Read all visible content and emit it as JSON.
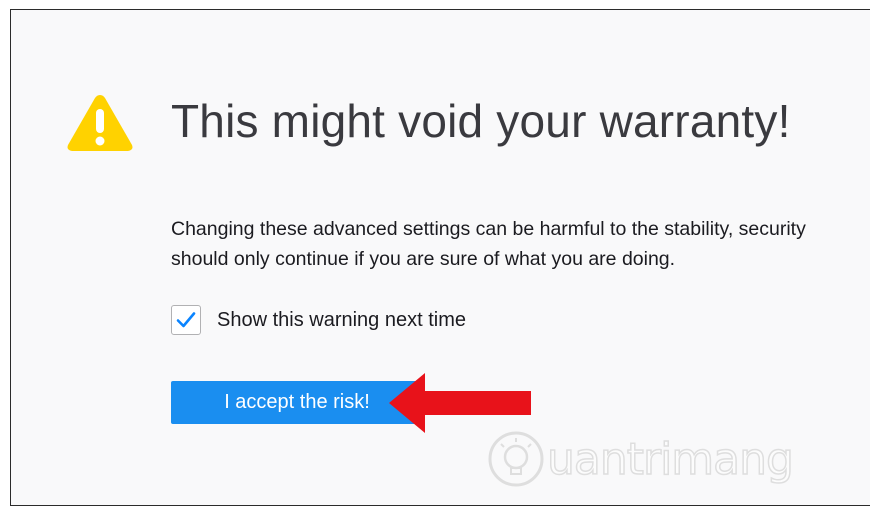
{
  "warning": {
    "icon": "warning-triangle-icon",
    "title": "This might void your warranty!",
    "description_lines": [
      "Changing these advanced settings can be harmful to the stability, security",
      "should only continue if you are sure of what you are doing."
    ],
    "checkbox": {
      "label": "Show this warning next time",
      "checked": true
    },
    "accept_button": "I accept the risk!"
  },
  "watermark": {
    "text": "uantrimang"
  },
  "colors": {
    "warning_yellow": "#ffd200",
    "button_blue": "#1a8ef0",
    "check_blue": "#0a84ff",
    "arrow_red": "#e8121a",
    "background": "#f9f9fa"
  }
}
